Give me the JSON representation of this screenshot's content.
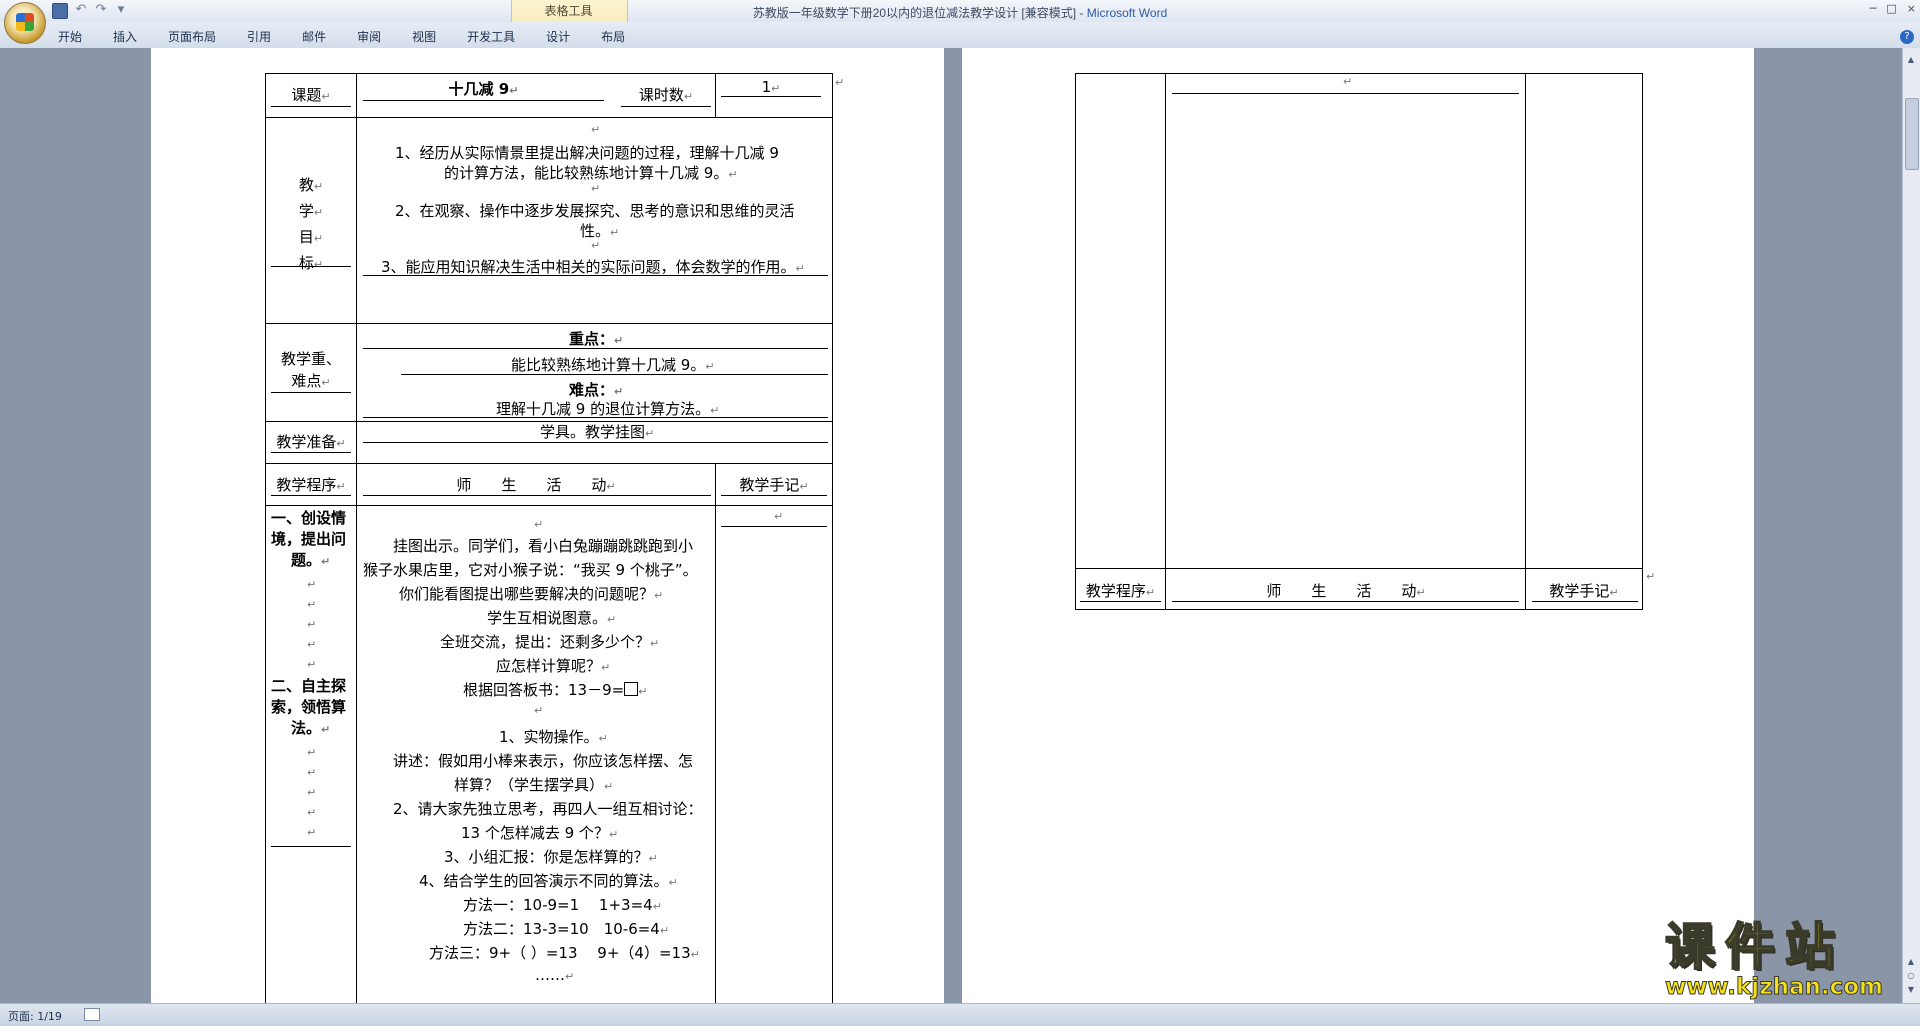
{
  "window": {
    "title_prefix": "苏教版一年级数学下册20以内的退位减法教学设计 [兼容模式] - ",
    "title_app": "Microsoft Word",
    "context_tab": "表格工具",
    "min": "─",
    "max": "□",
    "close": "×",
    "help": "?"
  },
  "ribbon_tabs": [
    "开始",
    "插入",
    "页面布局",
    "引用",
    "邮件",
    "审阅",
    "视图",
    "开发工具",
    "设计",
    "布局"
  ],
  "status": {
    "page": "页面: 1/19"
  },
  "watermark": {
    "main": "课件站",
    "url": "www.kjzhan.com"
  },
  "para": "↵",
  "lesson": {
    "topic_label": "课题",
    "topic": "十几减 9",
    "hours_label": "课时数",
    "hours": "1",
    "goals_label": [
      "教",
      "学",
      "目",
      "标"
    ],
    "goal1_l1": "1、经历从实际情景里提出解决问题的过程，理解十几减 9",
    "goal1_l2": "的计算方法，能比较熟练地计算十几减 9。",
    "goal2_l1": "2、在观察、操作中逐步发展探究、思考的意识和思维的灵活",
    "goal2_l2": "性。",
    "goal3": "3、能应用知识解决生活中相关的实际问题，体会数学的作用。",
    "key_label_l1": "教学重、",
    "key_label_l2": "难点",
    "key_title": "重点：",
    "key_text": "能比较熟练地计算十几减 9。",
    "diff_title": "难点：",
    "diff_text": "理解十几减 9 的退位计算方法。",
    "prep_label": "教学准备",
    "prep_text": "学具。教学挂图",
    "proc_label": "教学程序",
    "activity_label": "师　　生　　活　　动",
    "notes_label": "教学手记",
    "sec1_l1": "一、创设情",
    "sec1_l2": "境，提出问",
    "sec1_l3": "题。",
    "sec2_l1": "二、自主探",
    "sec2_l2": "索，领悟算",
    "sec2_l3": "法。",
    "act": [
      "挂图出示。同学们，看小白兔蹦蹦跳跳跑到小",
      "猴子水果店里，它对小猴子说：“我买 9 个桃子”。",
      "你们能看图提出哪些要解决的问题呢？",
      "学生互相说图意。",
      "全班交流，提出：还剩多少个？",
      "应怎样计算呢？",
      "根据回答板书：13－9=",
      "1、实物操作。",
      "讲述：假如用小棒来表示，你应该怎样摆、怎",
      "样算？（学生摆学具）",
      "2、请大家先独立思考，再四人一组互相讨论：",
      "13 个怎样减去 9 个？",
      "3、小组汇报：你是怎样算的？",
      "4、结合学生的回答演示不同的算法。",
      "方法一：10-9=1　 1+3=4",
      "方法二：13-3=10　10-6=4",
      "方法三：9+（ ）=13　 9+（4）=13",
      "……"
    ]
  }
}
